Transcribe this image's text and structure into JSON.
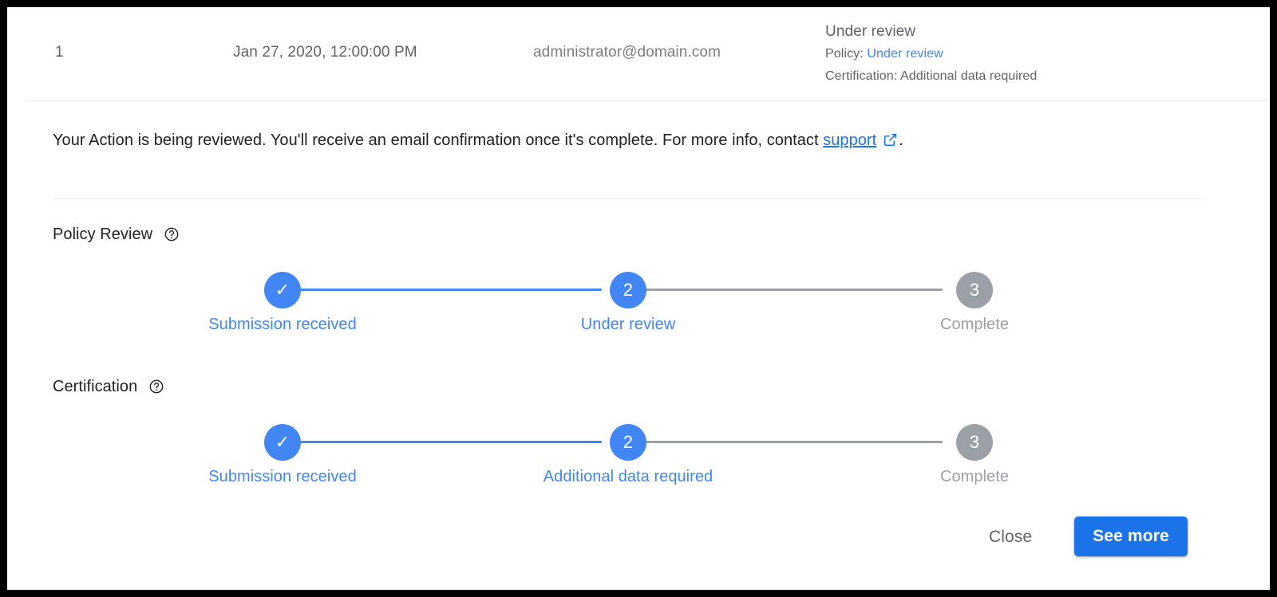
{
  "colors": {
    "accent_blue": "#4285f4",
    "button_blue": "#1a73e8",
    "link_blue": "#1a73e8",
    "inactive_gray": "#9aa0a6",
    "text_dark": "#202124",
    "text_muted": "#5f6368",
    "divider": "#e8eaed",
    "frame": "#000000"
  },
  "header": {
    "index": "1",
    "date": "Jan 27, 2020, 12:00:00 PM",
    "email": "administrator@domain.com",
    "status_title": "Under review",
    "policy_prefix": "Policy:",
    "policy_value": "Under review",
    "certification_line": "Certification: Additional data required"
  },
  "message": {
    "before_link": "Your Action is being reviewed. You'll receive an email confirmation once it's complete. For more info, contact ",
    "link_text": "support",
    "link_icon": "open-in-new-icon",
    "after_link": "."
  },
  "sections": [
    {
      "title": "Policy Review",
      "help_icon": "help-circle-icon",
      "steps": [
        {
          "marker": "✓",
          "label": "Submission received",
          "state": "active"
        },
        {
          "marker": "2",
          "label": "Under review",
          "state": "active"
        },
        {
          "marker": "3",
          "label": "Complete",
          "state": "inactive"
        }
      ],
      "connectors": [
        "done",
        "todo"
      ]
    },
    {
      "title": "Certification",
      "help_icon": "help-circle-icon",
      "steps": [
        {
          "marker": "✓",
          "label": "Submission received",
          "state": "active"
        },
        {
          "marker": "2",
          "label": "Additional data required",
          "state": "active"
        },
        {
          "marker": "3",
          "label": "Complete",
          "state": "inactive"
        }
      ],
      "connectors": [
        "done",
        "todo"
      ]
    }
  ],
  "footer": {
    "close_label": "Close",
    "see_more_label": "See more"
  }
}
